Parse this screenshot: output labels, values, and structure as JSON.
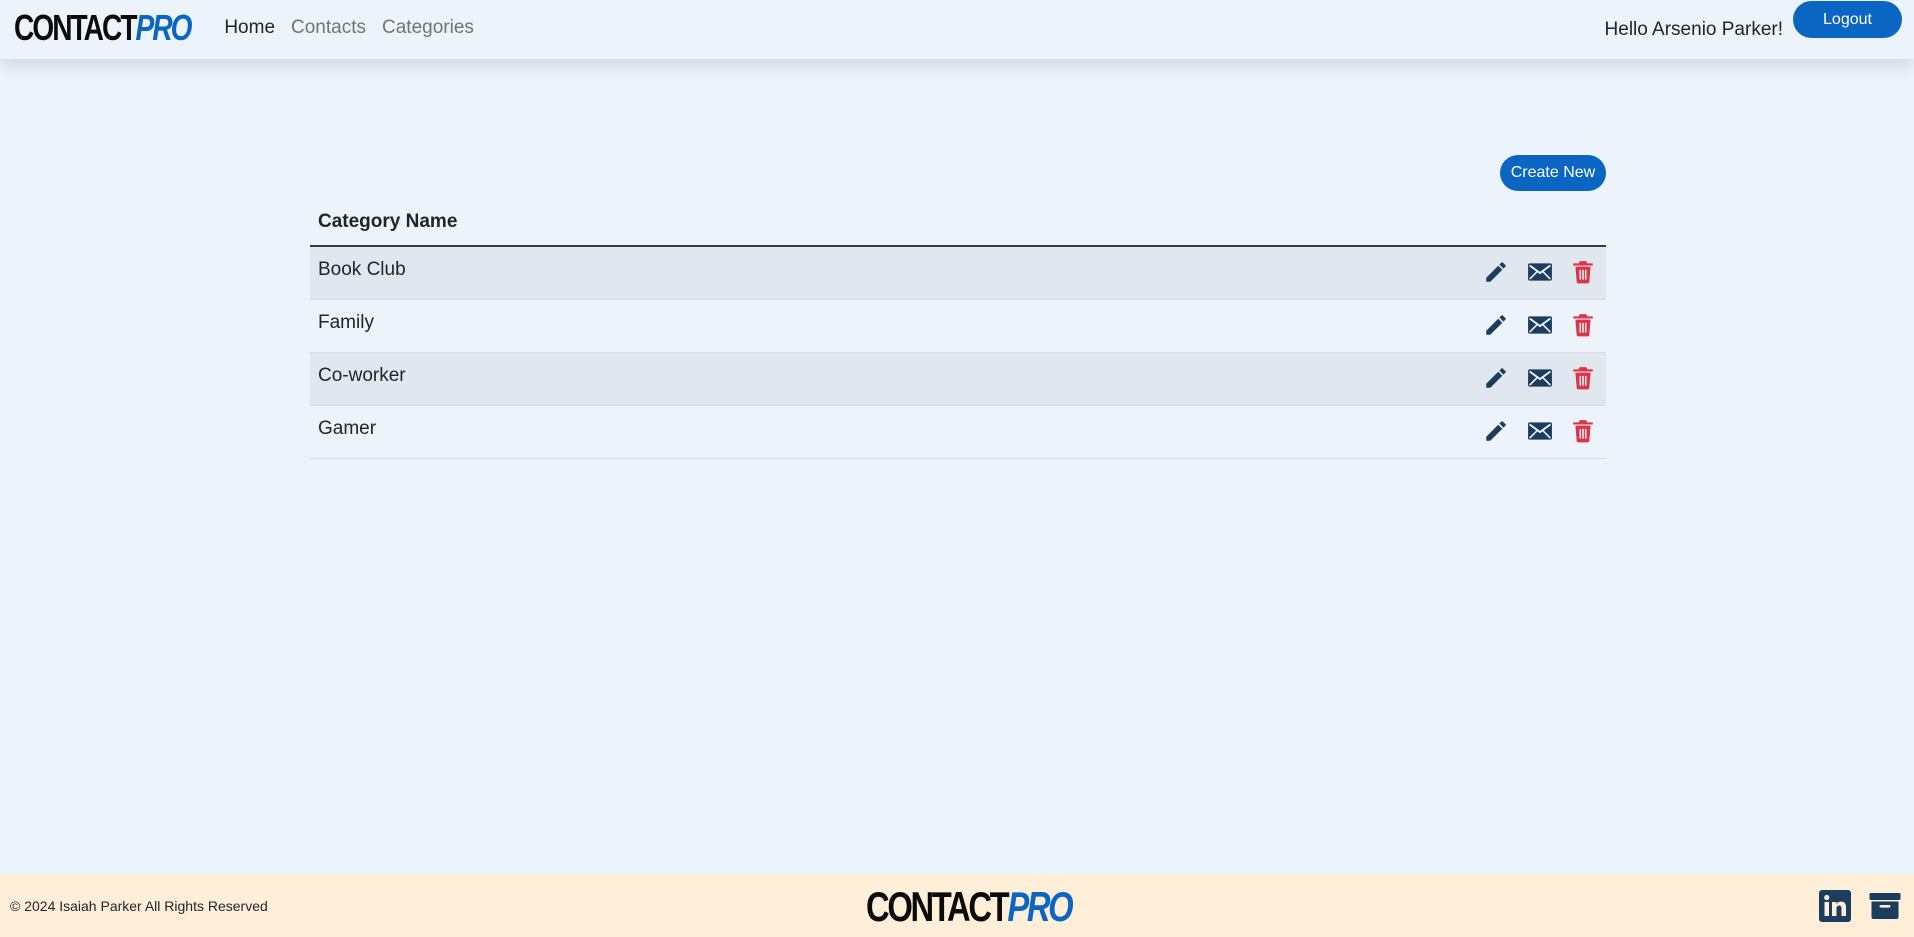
{
  "brand": {
    "part1": "CONTACT",
    "part2": "PRO"
  },
  "nav": {
    "links": [
      {
        "label": "Home",
        "active": true
      },
      {
        "label": "Contacts",
        "active": false
      },
      {
        "label": "Categories",
        "active": false
      }
    ],
    "greeting": "Hello Arsenio Parker!",
    "logout_label": "Logout"
  },
  "main": {
    "create_label": "Create New",
    "column_header": "Category Name",
    "rows": [
      {
        "name": "Book Club"
      },
      {
        "name": "Family"
      },
      {
        "name": "Co-worker"
      },
      {
        "name": "Gamer"
      }
    ],
    "row_actions": [
      "edit-icon",
      "email-icon",
      "delete-icon"
    ]
  },
  "footer": {
    "copyright": "© 2024 Isaiah Parker All Rights Reserved",
    "icons": [
      "linkedin-icon",
      "portfolio-icon"
    ]
  },
  "colors": {
    "accent": "#0b66c3",
    "icon_dark": "#1c3d5e",
    "danger": "#dc3545",
    "page_bg": "#ecf3fb",
    "footer_bg": "#ffefd8"
  }
}
